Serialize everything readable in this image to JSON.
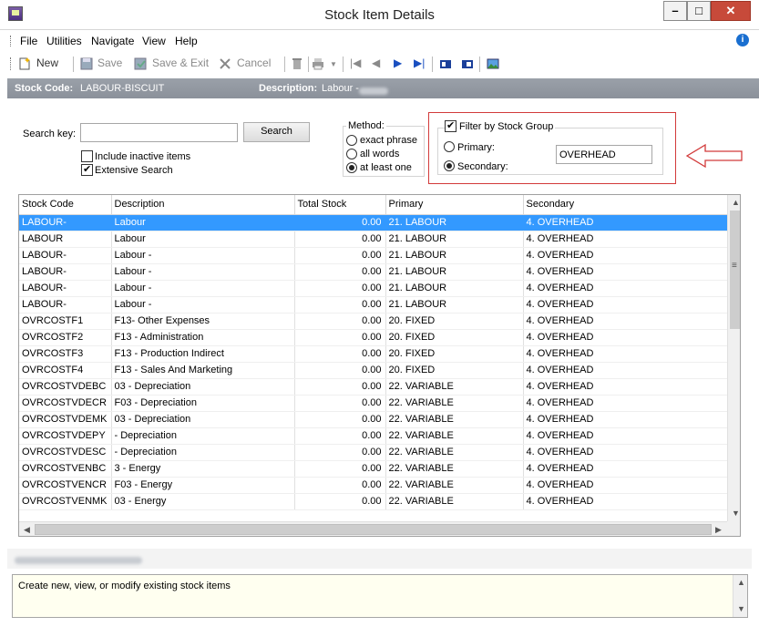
{
  "window": {
    "title": "Stock Item Details"
  },
  "menu": [
    "File",
    "Utilities",
    "Navigate",
    "View",
    "Help"
  ],
  "toolbar": {
    "new": "New",
    "save": "Save",
    "save_exit": "Save & Exit",
    "cancel": "Cancel"
  },
  "header": {
    "stock_code_label": "Stock Code:",
    "stock_code_value": "LABOUR-BISCUIT",
    "description_label": "Description:",
    "description_value": "Labour -"
  },
  "search": {
    "key_label": "Search key:",
    "key_value": "",
    "button": "Search",
    "include_inactive": {
      "label": "Include inactive items",
      "checked": false
    },
    "extensive": {
      "label": "Extensive Search",
      "checked": true
    }
  },
  "method": {
    "title": "Method:",
    "options": [
      "exact phrase",
      "all words",
      "at least one"
    ],
    "selected": "at least one"
  },
  "filter": {
    "label": "Filter by Stock Group",
    "checked": true,
    "primary_label": "Primary:",
    "secondary_label": "Secondary:",
    "selected": "Secondary",
    "value": "OVERHEAD"
  },
  "grid": {
    "columns": [
      "Stock Code",
      "Description",
      "Total Stock",
      "Primary",
      "Secondary"
    ],
    "rows": [
      [
        "LABOUR-",
        "Labour",
        "0.00",
        "21. LABOUR",
        "4. OVERHEAD"
      ],
      [
        "LABOUR",
        "Labour",
        "0.00",
        "21. LABOUR",
        "4. OVERHEAD"
      ],
      [
        "LABOUR-",
        "Labour -",
        "0.00",
        "21. LABOUR",
        "4. OVERHEAD"
      ],
      [
        "LABOUR-",
        "Labour -",
        "0.00",
        "21. LABOUR",
        "4. OVERHEAD"
      ],
      [
        "LABOUR-",
        "Labour -",
        "0.00",
        "21. LABOUR",
        "4. OVERHEAD"
      ],
      [
        "LABOUR-",
        "Labour -",
        "0.00",
        "21. LABOUR",
        "4. OVERHEAD"
      ],
      [
        "OVRCOSTF1",
        "F13- Other Expenses",
        "0.00",
        "20. FIXED",
        "4. OVERHEAD"
      ],
      [
        "OVRCOSTF2",
        "F13 - Administration",
        "0.00",
        "20. FIXED",
        "4. OVERHEAD"
      ],
      [
        "OVRCOSTF3",
        "F13 - Production Indirect",
        "0.00",
        "20. FIXED",
        "4. OVERHEAD"
      ],
      [
        "OVRCOSTF4",
        "F13 - Sales And Marketing",
        "0.00",
        "20. FIXED",
        "4. OVERHEAD"
      ],
      [
        "OVRCOSTVDEBC",
        "03 - Depreciation",
        "0.00",
        "22. VARIABLE",
        "4. OVERHEAD"
      ],
      [
        "OVRCOSTVDECR",
        "F03 - Depreciation",
        "0.00",
        "22. VARIABLE",
        "4. OVERHEAD"
      ],
      [
        "OVRCOSTVDEMK",
        "03 - Depreciation",
        "0.00",
        "22. VARIABLE",
        "4. OVERHEAD"
      ],
      [
        "OVRCOSTVDEPY",
        "- Depreciation",
        "0.00",
        "22. VARIABLE",
        "4. OVERHEAD"
      ],
      [
        "OVRCOSTVDESC",
        "- Depreciation",
        "0.00",
        "22. VARIABLE",
        "4. OVERHEAD"
      ],
      [
        "OVRCOSTVENBC",
        "3 - Energy",
        "0.00",
        "22. VARIABLE",
        "4. OVERHEAD"
      ],
      [
        "OVRCOSTVENCR",
        "F03 - Energy",
        "0.00",
        "22. VARIABLE",
        "4. OVERHEAD"
      ],
      [
        "OVRCOSTVENMK",
        "03 - Energy",
        "0.00",
        "22. VARIABLE",
        "4. OVERHEAD"
      ]
    ],
    "selected_row": 0
  },
  "status": {
    "description": "Create new, view, or modify existing stock items"
  }
}
